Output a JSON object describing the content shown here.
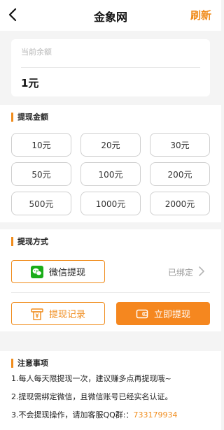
{
  "header": {
    "title": "金象网",
    "refresh_label": "刷新",
    "back_icon": "chevron-left-icon"
  },
  "balance": {
    "label": "当前余额",
    "value": "1元"
  },
  "amount_section": {
    "title": "提现金额",
    "options": [
      "10元",
      "20元",
      "30元",
      "50元",
      "100元",
      "200元",
      "500元",
      "1000元",
      "2000元"
    ]
  },
  "method_section": {
    "title": "提现方式",
    "wechat_label": "微信提现",
    "bound_status": "已绑定",
    "record_label": "提现记录",
    "withdraw_label": "立即提现"
  },
  "notice_section": {
    "title": "注意事项",
    "items": [
      "1.每人每天限提现一次，建议赚多点再提现哦~",
      "2.提现需绑定微信，且微信账号已经实名认证。",
      "3.不会提现操作，请加客服QQ群:："
    ],
    "qq_group": "733179934"
  },
  "colors": {
    "accent": "#f08c1c",
    "wechat": "#1aad19",
    "background": "#f4f4f4"
  }
}
